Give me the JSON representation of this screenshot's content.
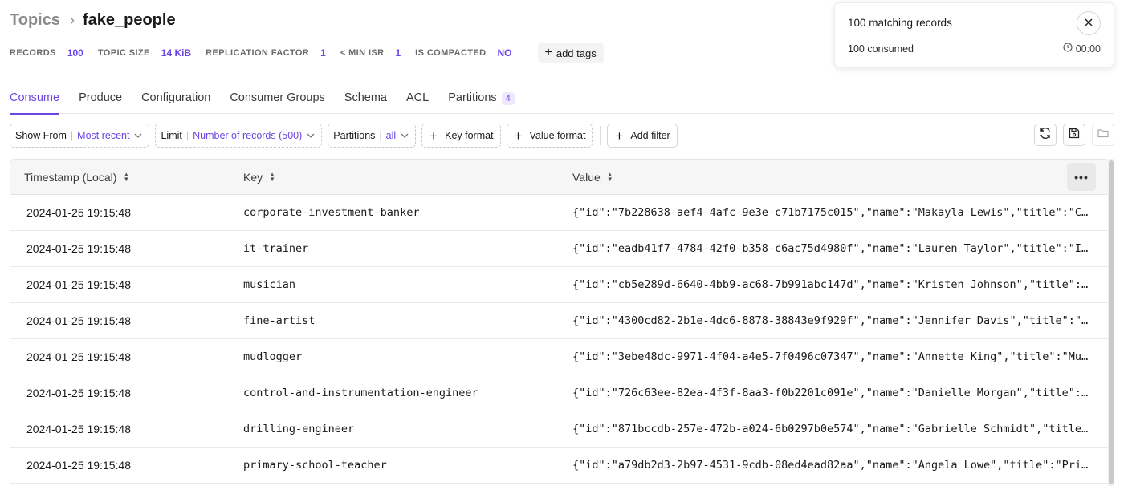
{
  "breadcrumb": {
    "parent": "Topics",
    "separator": "›",
    "current": "fake_people"
  },
  "stats": [
    {
      "label": "RECORDS",
      "value": "100"
    },
    {
      "label": "TOPIC SIZE",
      "value": "14 KiB"
    },
    {
      "label": "REPLICATION FACTOR",
      "value": "1"
    },
    {
      "label": "< MIN ISR",
      "value": "1"
    },
    {
      "label": "IS COMPACTED",
      "value": "NO"
    }
  ],
  "add_tags_label": "add tags",
  "tabs": [
    {
      "label": "Consume",
      "active": true
    },
    {
      "label": "Produce"
    },
    {
      "label": "Configuration"
    },
    {
      "label": "Consumer Groups"
    },
    {
      "label": "Schema"
    },
    {
      "label": "ACL"
    },
    {
      "label": "Partitions",
      "badge": "4"
    }
  ],
  "toolbar": {
    "show_from": {
      "label": "Show From",
      "value": "Most recent"
    },
    "limit": {
      "label": "Limit",
      "value": "Number of records (500)"
    },
    "partitions": {
      "label": "Partitions",
      "value": "all"
    },
    "key_format": "Key format",
    "value_format": "Value format",
    "add_filter": "Add filter"
  },
  "table": {
    "columns": [
      "Timestamp (Local)",
      "Key",
      "Value"
    ],
    "rows": [
      {
        "timestamp": "2024-01-25 19:15:48",
        "key": "corporate-investment-banker",
        "value": "{\"id\":\"7b228638-aef4-4afc-9e3e-c71b7175c015\",\"name\":\"Makayla Lewis\",\"title\":\"Corporate investment banker\"}"
      },
      {
        "timestamp": "2024-01-25 19:15:48",
        "key": "it-trainer",
        "value": "{\"id\":\"eadb41f7-4784-42f0-b358-c6ac75d4980f\",\"name\":\"Lauren Taylor\",\"title\":\"IT trainer\"}"
      },
      {
        "timestamp": "2024-01-25 19:15:48",
        "key": "musician",
        "value": "{\"id\":\"cb5e289d-6640-4bb9-ac68-7b991abc147d\",\"name\":\"Kristen Johnson\",\"title\":\"Musician\"}"
      },
      {
        "timestamp": "2024-01-25 19:15:48",
        "key": "fine-artist",
        "value": "{\"id\":\"4300cd82-2b1e-4dc6-8878-38843e9f929f\",\"name\":\"Jennifer Davis\",\"title\":\"Fine artist\"}"
      },
      {
        "timestamp": "2024-01-25 19:15:48",
        "key": "mudlogger",
        "value": "{\"id\":\"3ebe48dc-9971-4f04-a4e5-7f0496c07347\",\"name\":\"Annette King\",\"title\":\"Mudlogger\"}"
      },
      {
        "timestamp": "2024-01-25 19:15:48",
        "key": "control-and-instrumentation-engineer",
        "value": "{\"id\":\"726c63ee-82ea-4f3f-8aa3-f0b2201c091e\",\"name\":\"Danielle Morgan\",\"title\":\"Control and instrumentation engineer\"}"
      },
      {
        "timestamp": "2024-01-25 19:15:48",
        "key": "drilling-engineer",
        "value": "{\"id\":\"871bccdb-257e-472b-a024-6b0297b0e574\",\"name\":\"Gabrielle Schmidt\",\"title\":\"Drilling engineer\"}"
      },
      {
        "timestamp": "2024-01-25 19:15:48",
        "key": "primary-school-teacher",
        "value": "{\"id\":\"a79db2d3-2b97-4531-9cdb-08ed4ead82aa\",\"name\":\"Angela Lowe\",\"title\":\"Primary school teacher\"}"
      }
    ]
  },
  "notification": {
    "title": "100 matching records",
    "consumed": "100 consumed",
    "elapsed": "00:00"
  },
  "colors": {
    "accent": "#6b46e5"
  },
  "icons": [
    "chevron-right-icon",
    "plus-icon",
    "chevron-down-icon",
    "refresh-icon",
    "save-icon",
    "folder-icon",
    "sort-icon",
    "more-icon",
    "close-icon",
    "clock-icon"
  ]
}
